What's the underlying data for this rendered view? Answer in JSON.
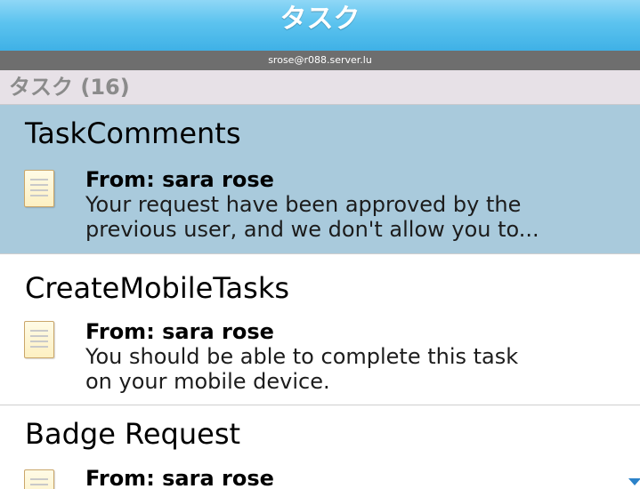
{
  "header": {
    "title": "タスク",
    "account": "srose@r088.server.lu"
  },
  "section": {
    "label": "タスク (16)"
  },
  "tasks": [
    {
      "title": "TaskComments",
      "from": "From: sara rose",
      "description_line1": "Your request have been approved by the",
      "description_line2": "previous user, and we don't allow you to...",
      "selected": true
    },
    {
      "title": "CreateMobileTasks",
      "from": "From: sara rose",
      "description_line1": "You should be able to complete this task",
      "description_line2": "on your mobile device.",
      "selected": false
    },
    {
      "title": "Badge Request",
      "from": "From: sara rose",
      "selected": false
    }
  ],
  "icons": {
    "task": "document-icon",
    "scroll": "scroll-down-arrow-icon"
  },
  "colors": {
    "title_bar": "#5cc3ef",
    "selected_row": "#a9cadc",
    "section_header": "#e7e1e7",
    "account_bar": "#6e6e6e"
  }
}
